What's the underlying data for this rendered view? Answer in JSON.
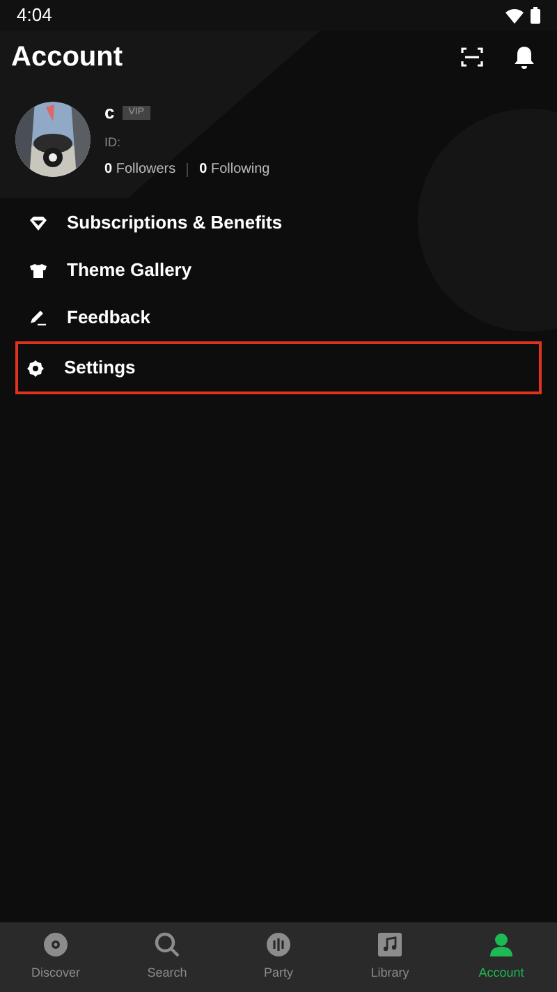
{
  "status_bar": {
    "time": "4:04"
  },
  "header": {
    "title": "Account"
  },
  "profile": {
    "name": "c",
    "badge": "VIP",
    "id_label": "ID:",
    "followers_count": "0",
    "followers_label": "Followers",
    "following_count": "0",
    "following_label": "Following"
  },
  "menu": [
    {
      "kind": "diamond",
      "label": "Subscriptions & Benefits",
      "highlighted": false
    },
    {
      "kind": "shirt",
      "label": "Theme Gallery",
      "highlighted": false
    },
    {
      "kind": "pen",
      "label": "Feedback",
      "highlighted": false
    },
    {
      "kind": "gear",
      "label": "Settings",
      "highlighted": true
    }
  ],
  "bottom_nav": [
    {
      "kind": "disc",
      "label": "Discover",
      "selected": false
    },
    {
      "kind": "search",
      "label": "Search",
      "selected": false
    },
    {
      "kind": "party",
      "label": "Party",
      "selected": false
    },
    {
      "kind": "library",
      "label": "Library",
      "selected": false
    },
    {
      "kind": "person",
      "label": "Account",
      "selected": true
    }
  ]
}
